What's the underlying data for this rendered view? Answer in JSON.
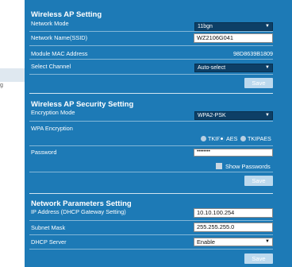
{
  "sidebar": {
    "partial_label": "g"
  },
  "wireless": {
    "title": "Wireless AP Setting",
    "mode_label": "Network Mode",
    "mode_value": "11bgn",
    "ssid_label": "Network Name(SSID)",
    "ssid_value": "WZ2106G041",
    "mac_label": "Module MAC Address",
    "mac_value": "98D8639B1809",
    "channel_label": "Select Channel",
    "channel_value": "Auto-select",
    "save": "Save"
  },
  "security": {
    "title": "Wireless AP Security Setting",
    "enc_mode_label": "Encryption Mode",
    "enc_mode_value": "WPA2-PSK",
    "wpa_label": "WPA Encryption",
    "opt_tkip": "TKIP",
    "opt_aes": "AES",
    "opt_tkipaes": "TKIPAES",
    "selected": "AES",
    "password_label": "Password",
    "password_value": "••••••••",
    "show_pw": "Show Passwords",
    "save": "Save"
  },
  "network": {
    "title": "Network Parameters Setting",
    "ip_label": "IP Address (DHCP Gateway Setting)",
    "ip_value": "10.10.100.254",
    "mask_label": "Subnet Mask",
    "mask_value": "255.255.255.0",
    "dhcp_label": "DHCP Server",
    "dhcp_value": "Enable",
    "save": "Save"
  }
}
